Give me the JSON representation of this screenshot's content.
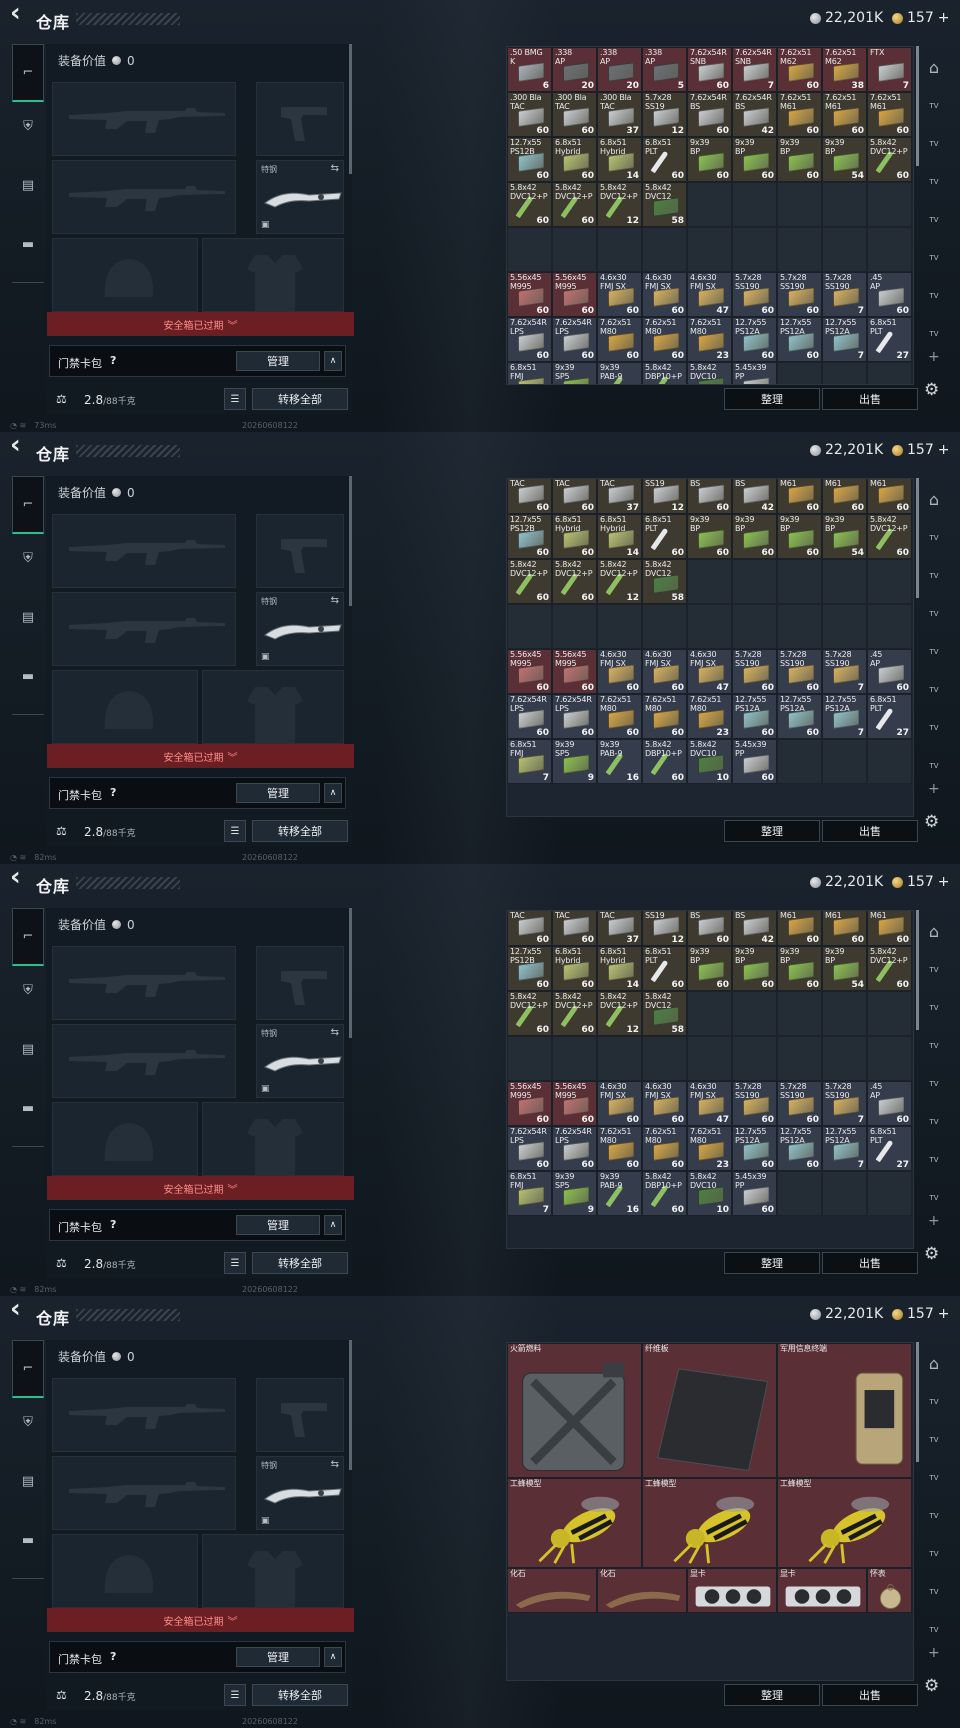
{
  "header": {
    "title": "仓库",
    "silver": "22,201K",
    "gold": "157",
    "gold_plus": "+"
  },
  "left_nav": [
    {
      "name": "nav-weapons",
      "icon": "pistol-icon"
    },
    {
      "name": "nav-armor",
      "icon": "vest-icon"
    },
    {
      "name": "nav-rig",
      "icon": "rig-icon"
    },
    {
      "name": "nav-case",
      "icon": "briefcase-icon"
    }
  ],
  "equipment": {
    "value_label": "装备价值",
    "value": "0",
    "melee_label": "特钢",
    "safe_box_expired": "安全箱已过期",
    "keycard_label": "门禁卡包",
    "keycard_help": "?",
    "manage_label": "管理",
    "weight": "2.8",
    "weight_max": "/88千克",
    "transfer_label": "转移全部"
  },
  "status": {
    "ping": [
      "73ms",
      "82ms",
      "82ms",
      "82ms"
    ],
    "build": "20260608122"
  },
  "stash_actions": {
    "sort": "整理",
    "sell": "出售"
  },
  "right_bar": [
    "locker-icon",
    "tv-icon",
    "tv-icon",
    "tv-icon",
    "tv-icon",
    "tv-icon",
    "tv-icon",
    "tv-icon"
  ],
  "stash_rows": [
    {
      "type": "orange",
      "tint": "red",
      "cells": [
        {
          "n": ".50 BMG",
          "l2": "K",
          "c": "6",
          "box": "#a8b0b8"
        },
        {
          "n": ".338",
          "l2": "AP",
          "c": "20",
          "box": "#6b7075"
        },
        {
          "n": ".338",
          "l2": "AP",
          "c": "20",
          "box": "#6b7075"
        },
        {
          "n": ".338",
          "l2": "AP",
          "c": "5",
          "box": "#6b7075"
        },
        {
          "n": "7.62x54R",
          "l2": "SNB",
          "c": "60",
          "box": "#c8ccd0"
        },
        {
          "n": "7.62x54R",
          "l2": "SNB",
          "c": "7",
          "box": "#c8ccd0"
        },
        {
          "n": "7.62x51",
          "l2": "M62",
          "c": "60",
          "box": "#d6a545"
        },
        {
          "n": "7.62x51",
          "l2": "M62",
          "c": "38",
          "box": "#d6a545"
        },
        {
          "n": "FTX",
          "l2": "",
          "c": "7",
          "box": "#c8ccd0"
        }
      ]
    },
    {
      "type": "orange",
      "cells": [
        {
          "n": ".300 Bla",
          "l2": "TAC",
          "c": "60",
          "box": "#c8ccd0"
        },
        {
          "n": ".300 Bla",
          "l2": "TAC",
          "c": "60",
          "box": "#c8ccd0"
        },
        {
          "n": ".300 Bla",
          "l2": "TAC",
          "c": "37",
          "box": "#c8ccd0"
        },
        {
          "n": "5.7x28",
          "l2": "SS19",
          "c": "12",
          "box": "#c8ccd0"
        },
        {
          "n": "7.62x54R",
          "l2": "BS",
          "c": "60",
          "box": "#c8ccd0"
        },
        {
          "n": "7.62x54R",
          "l2": "BS",
          "c": "42",
          "box": "#c8ccd0"
        },
        {
          "n": "7.62x51",
          "l2": "M61",
          "c": "60",
          "box": "#d6a545"
        },
        {
          "n": "7.62x51",
          "l2": "M61",
          "c": "60",
          "box": "#d6a545"
        },
        {
          "n": "7.62x51",
          "l2": "M61",
          "c": "60",
          "box": "#d6a545"
        }
      ]
    },
    {
      "type": "orange",
      "cells": [
        {
          "n": "12.7x55",
          "l2": "PS12B",
          "c": "60",
          "box": "#8fc0c8"
        },
        {
          "n": "6.8x51",
          "l2": "Hybrid",
          "c": "60",
          "box": "#b6c070"
        },
        {
          "n": "6.8x51",
          "l2": "Hybrid",
          "c": "14",
          "box": "#b6c070"
        },
        {
          "n": "6.8x51",
          "l2": "PLT",
          "c": "60",
          "bullet": "#e6e8ea"
        },
        {
          "n": "9x39",
          "l2": "BP",
          "c": "60",
          "box": "#8ac050"
        },
        {
          "n": "9x39",
          "l2": "BP",
          "c": "60",
          "box": "#8ac050"
        },
        {
          "n": "9x39",
          "l2": "BP",
          "c": "60",
          "box": "#8ac050"
        },
        {
          "n": "9x39",
          "l2": "BP",
          "c": "54",
          "box": "#8ac050"
        },
        {
          "n": "5.8x42",
          "l2": "DVC12+P",
          "c": "60",
          "bullet": "#8cc060"
        }
      ]
    },
    {
      "type": "orange",
      "cells": [
        {
          "n": "5.8x42",
          "l2": "DVC12+P",
          "c": "60",
          "bullet": "#8cc060"
        },
        {
          "n": "5.8x42",
          "l2": "DVC12+P",
          "c": "60",
          "bullet": "#8cc060"
        },
        {
          "n": "5.8x42",
          "l2": "DVC12+P",
          "c": "12",
          "bullet": "#8cc060"
        },
        {
          "n": "5.8x42",
          "l2": "DVC12",
          "c": "58",
          "box": "#4a8040"
        }
      ]
    },
    {
      "type": "empty"
    },
    {
      "type": "blue",
      "tint_first": true,
      "cells": [
        {
          "n": "5.56x45",
          "l2": "M995",
          "c": "60",
          "box": "#c07070"
        },
        {
          "n": "5.56x45",
          "l2": "M995",
          "c": "60",
          "box": "#c07070"
        },
        {
          "n": "4.6x30",
          "l2": "FMJ SX",
          "c": "60",
          "box": "#d6b060"
        },
        {
          "n": "4.6x30",
          "l2": "FMJ SX",
          "c": "60",
          "box": "#d6b060"
        },
        {
          "n": "4.6x30",
          "l2": "FMJ SX",
          "c": "47",
          "box": "#d6b060"
        },
        {
          "n": "5.7x28",
          "l2": "SS190",
          "c": "60",
          "box": "#d6b060"
        },
        {
          "n": "5.7x28",
          "l2": "SS190",
          "c": "60",
          "box": "#d6b060"
        },
        {
          "n": "5.7x28",
          "l2": "SS190",
          "c": "7",
          "box": "#d6b060"
        },
        {
          "n": ".45",
          "l2": "AP",
          "c": "60",
          "box": "#c8ccd0"
        }
      ]
    },
    {
      "type": "blue",
      "cells": [
        {
          "n": "7.62x54R",
          "l2": "LPS",
          "c": "60",
          "box": "#c8ccd0"
        },
        {
          "n": "7.62x54R",
          "l2": "LPS",
          "c": "60",
          "box": "#c8ccd0"
        },
        {
          "n": "7.62x51",
          "l2": "M80",
          "c": "60",
          "box": "#d6a545"
        },
        {
          "n": "7.62x51",
          "l2": "M80",
          "c": "60",
          "box": "#d6a545"
        },
        {
          "n": "7.62x51",
          "l2": "M80",
          "c": "23",
          "box": "#d6a545"
        },
        {
          "n": "12.7x55",
          "l2": "PS12A",
          "c": "60",
          "box": "#8fc0c8"
        },
        {
          "n": "12.7x55",
          "l2": "PS12A",
          "c": "60",
          "box": "#8fc0c8"
        },
        {
          "n": "12.7x55",
          "l2": "PS12A",
          "c": "7",
          "box": "#8fc0c8"
        },
        {
          "n": "6.8x51",
          "l2": "PLT",
          "c": "27",
          "bullet": "#e6e8ea"
        }
      ]
    },
    {
      "type": "blue",
      "cells": [
        {
          "n": "6.8x51",
          "l2": "FMJ",
          "c": "7",
          "box": "#b6c070"
        },
        {
          "n": "9x39",
          "l2": "SP5",
          "c": "9",
          "box": "#8ac050"
        },
        {
          "n": "9x39",
          "l2": "PAB-9",
          "c": "16",
          "bullet": "#8cc060"
        },
        {
          "n": "5.8x42",
          "l2": "DBP10+P",
          "c": "60",
          "bullet": "#8cc060"
        },
        {
          "n": "5.8x42",
          "l2": "DVC10",
          "c": "10",
          "box": "#4a8040"
        },
        {
          "n": "5.45x39",
          "l2": "PP",
          "c": "60",
          "box": "#c8ccd0"
        }
      ]
    }
  ],
  "frame_scroll": [
    0,
    155,
    155
  ],
  "big_items": {
    "row1": [
      {
        "n": "火箭燃料",
        "span": 3,
        "icon": "jerrycan-icon"
      },
      {
        "n": "纤维板",
        "span": 3,
        "icon": "carbon-plate-icon"
      },
      {
        "n": "军用信息终端",
        "span": 3,
        "icon": "terminal-icon"
      }
    ],
    "row2": [
      {
        "n": "工蜂模型",
        "icon": "wasp-icon"
      },
      {
        "n": "工蜂模型",
        "icon": "wasp-icon"
      },
      {
        "n": "工蜂模型",
        "icon": "wasp-icon"
      }
    ],
    "row3": [
      {
        "n": "化石",
        "span": 2,
        "icon": "fossil-icon"
      },
      {
        "n": "化石",
        "span": 2,
        "icon": "fossil-icon"
      },
      {
        "n": "显卡",
        "span": 2,
        "icon": "gpu-icon"
      },
      {
        "n": "显卡",
        "span": 2,
        "icon": "gpu-icon"
      },
      {
        "n": "怀表",
        "span": 1,
        "icon": "pocket-watch-icon"
      }
    ]
  }
}
